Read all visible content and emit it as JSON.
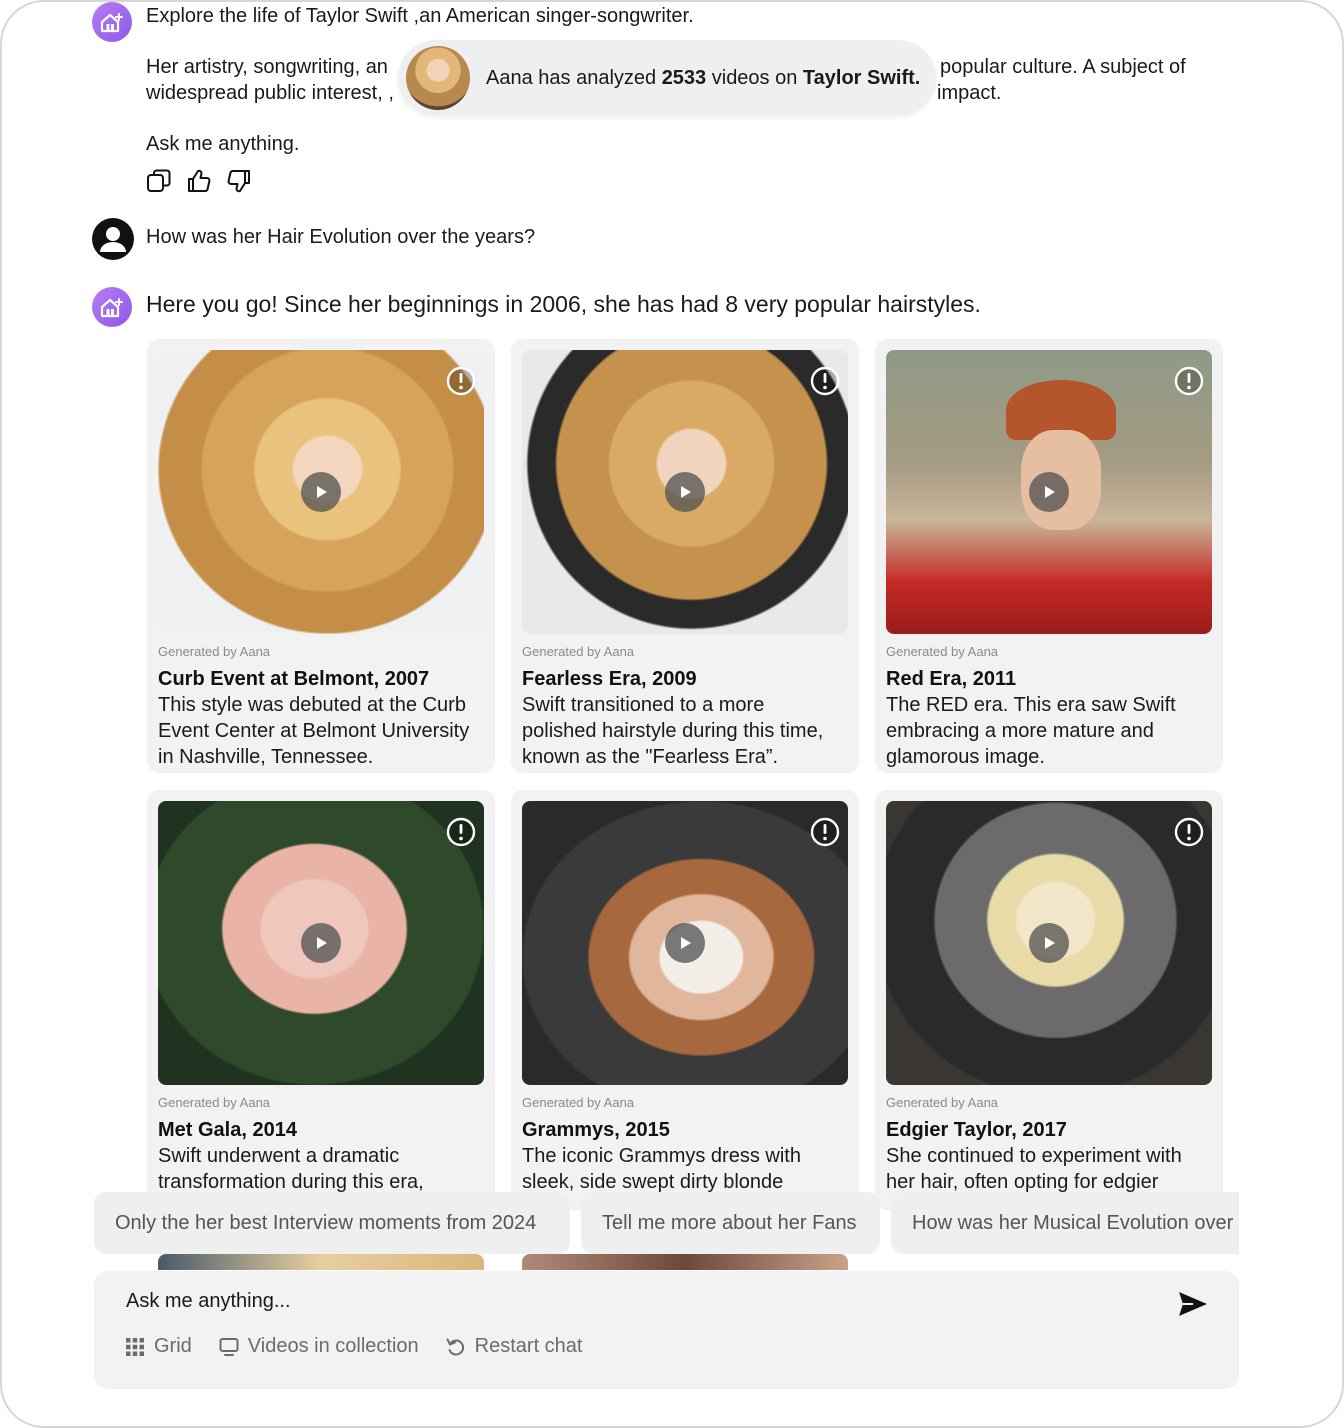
{
  "conversation": {
    "intro": {
      "line1": "Explore the life of Taylor Swift ,an American singer-songwriter.",
      "line2_left": "Her artistry, songwriting, an",
      "line2_right": "popular culture. A subject of",
      "line3_left": "widespread public interest, ,",
      "line3_right": "impact.",
      "ask": "Ask me anything."
    },
    "analyzed_pill": {
      "prefix": "Aana has analyzed ",
      "count": "2533",
      "middle": " videos on ",
      "subject": "Taylor Swift."
    },
    "user_question": "How was her Hair Evolution over the years?",
    "bot_answer": "Here you go! Since her beginnings in 2006, she has had 8 very popular hairstyles."
  },
  "cards": [
    {
      "generated_by": "Generated by Aana",
      "title": "Curb Event at Belmont, 2007",
      "desc_lines": [
        "This style was debuted at the Curb",
        "Event Center at Belmont University",
        "in Nashville, Tennessee."
      ]
    },
    {
      "generated_by": "Generated by Aana",
      "title": "Fearless Era, 2009",
      "desc_lines": [
        "Swift transitioned to a more",
        "polished hairstyle during this time,",
        "known as the \"Fearless Era”."
      ]
    },
    {
      "generated_by": "Generated by Aana",
      "title": "Red Era, 2011",
      "desc_lines": [
        "The RED era. This era saw Swift",
        "embracing a more mature and",
        "glamorous image."
      ]
    },
    {
      "generated_by": "Generated by Aana",
      "title": "Met Gala, 2014",
      "desc_lines": [
        "Swift underwent a dramatic",
        "transformation during this era,"
      ]
    },
    {
      "generated_by": "Generated by Aana",
      "title": "Grammys, 2015",
      "desc_lines": [
        "The iconic Grammys dress with",
        "sleek, side swept dirty blonde"
      ]
    },
    {
      "generated_by": "Generated by Aana",
      "title": "Edgier Taylor, 2017",
      "desc_lines": [
        "She continued to experiment with",
        "her hair, often opting for edgier"
      ]
    }
  ],
  "suggestions": [
    "Only the her best Interview moments from 2024",
    "Tell me more about her Fans",
    "How was her Musical Evolution over the years?"
  ],
  "composer": {
    "placeholder": "Ask me anything...",
    "tools": {
      "grid": "Grid",
      "videos": "Videos in collection",
      "restart": "Restart chat"
    }
  },
  "colors": {
    "accent": "#9b67f0",
    "card_bg": "#f2f2f2",
    "chip_bg": "#efefef"
  }
}
